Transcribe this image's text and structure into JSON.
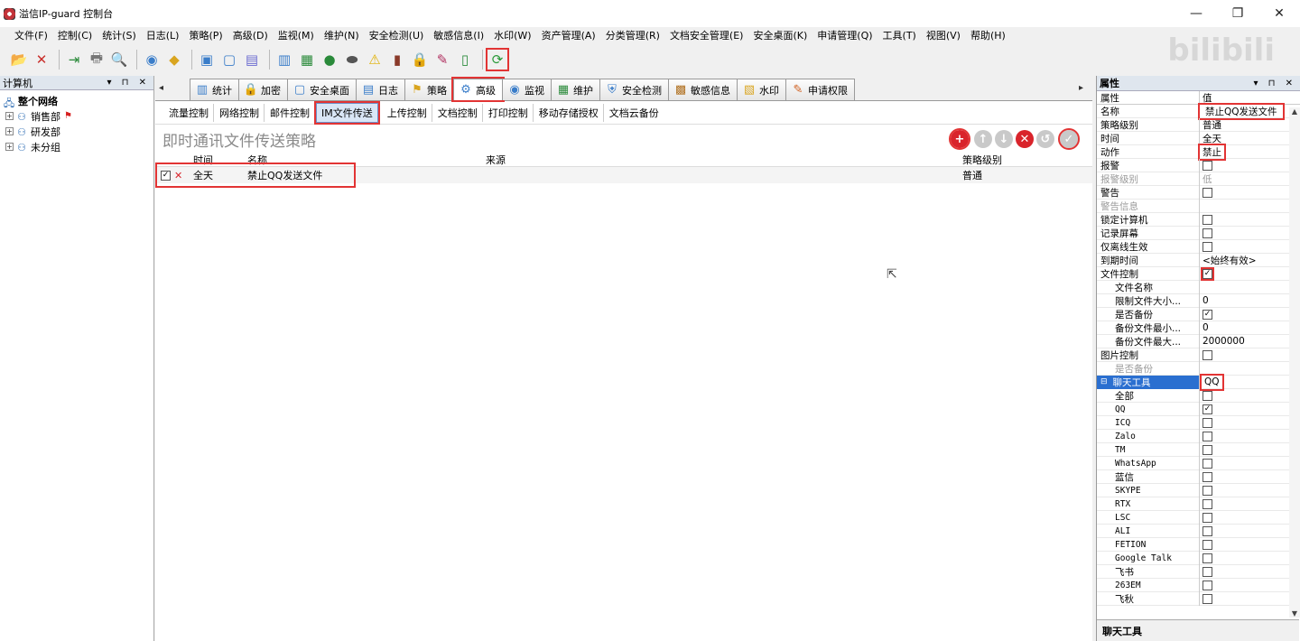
{
  "window": {
    "title": "溢信IP-guard 控制台",
    "controls": [
      "—",
      "❐",
      "✕"
    ]
  },
  "menu": [
    "文件(F)",
    "控制(C)",
    "统计(S)",
    "日志(L)",
    "策略(P)",
    "高级(D)",
    "监视(M)",
    "维护(N)",
    "安全检测(U)",
    "敏感信息(I)",
    "水印(W)",
    "资产管理(A)",
    "分类管理(R)",
    "文档安全管理(E)",
    "安全桌面(K)",
    "申请管理(Q)",
    "工具(T)",
    "视图(V)",
    "帮助(H)"
  ],
  "left_panel": {
    "title": "计算机",
    "tree": [
      {
        "label": "整个网络",
        "bold": true
      },
      {
        "label": "销售部"
      },
      {
        "label": "研发部"
      },
      {
        "label": "未分组"
      }
    ]
  },
  "tabs": [
    "统计",
    "加密",
    "安全桌面",
    "日志",
    "策略",
    "高级",
    "监视",
    "维护",
    "安全检测",
    "敏感信息",
    "水印",
    "申请权限"
  ],
  "active_tab": "高级",
  "subtabs": [
    "流量控制",
    "网络控制",
    "邮件控制",
    "IM文件传送",
    "上传控制",
    "文档控制",
    "打印控制",
    "移动存储授权",
    "文档云备份"
  ],
  "active_subtab": "IM文件传送",
  "policy": {
    "title": "即时通讯文件传送策略",
    "columns": [
      "时间",
      "名称",
      "来源",
      "策略级别"
    ],
    "rows": [
      {
        "time": "全天",
        "name": "禁止QQ发送文件",
        "source": "",
        "level": "普通"
      }
    ]
  },
  "properties": {
    "title": "属性",
    "header": {
      "name": "属性",
      "value": "值"
    },
    "rows": [
      {
        "name": "名称",
        "value": "禁止QQ发送文件"
      },
      {
        "name": "策略级别",
        "value": "普通"
      },
      {
        "name": "时间",
        "value": "全天"
      },
      {
        "name": "动作",
        "value": "禁止"
      },
      {
        "name": "报警",
        "value": ""
      },
      {
        "name": "报警级别",
        "value": "低"
      },
      {
        "name": "警告",
        "value": ""
      },
      {
        "name": "警告信息",
        "value": ""
      },
      {
        "name": "锁定计算机",
        "value": ""
      },
      {
        "name": "记录屏幕",
        "value": ""
      },
      {
        "name": "仅离线生效",
        "value": ""
      },
      {
        "name": "到期时间",
        "value": "<始终有效>"
      },
      {
        "name": "文件控制",
        "value": ""
      },
      {
        "name": "文件名称",
        "value": ""
      },
      {
        "name": "限制文件大小...",
        "value": "0"
      },
      {
        "name": "是否备份",
        "value": ""
      },
      {
        "name": "备份文件最小...",
        "value": "0"
      },
      {
        "name": "备份文件最大...",
        "value": "2000000"
      },
      {
        "name": "图片控制",
        "value": ""
      },
      {
        "name": "是否备份",
        "value": ""
      },
      {
        "name": "聊天工具",
        "value": "QQ"
      },
      {
        "name": "全部",
        "value": ""
      },
      {
        "name": "QQ",
        "value": ""
      },
      {
        "name": "ICQ",
        "value": ""
      },
      {
        "name": "Zalo",
        "value": ""
      },
      {
        "name": "TM",
        "value": ""
      },
      {
        "name": "WhatsApp",
        "value": ""
      },
      {
        "name": "蓝信",
        "value": ""
      },
      {
        "name": "SKYPE",
        "value": ""
      },
      {
        "name": "RTX",
        "value": ""
      },
      {
        "name": "LSC",
        "value": ""
      },
      {
        "name": "ALI",
        "value": ""
      },
      {
        "name": "FETION",
        "value": ""
      },
      {
        "name": "Google Talk",
        "value": ""
      },
      {
        "name": "飞书",
        "value": ""
      },
      {
        "name": "263EM",
        "value": ""
      },
      {
        "name": "飞秋",
        "value": ""
      }
    ],
    "description": "聊天工具"
  }
}
